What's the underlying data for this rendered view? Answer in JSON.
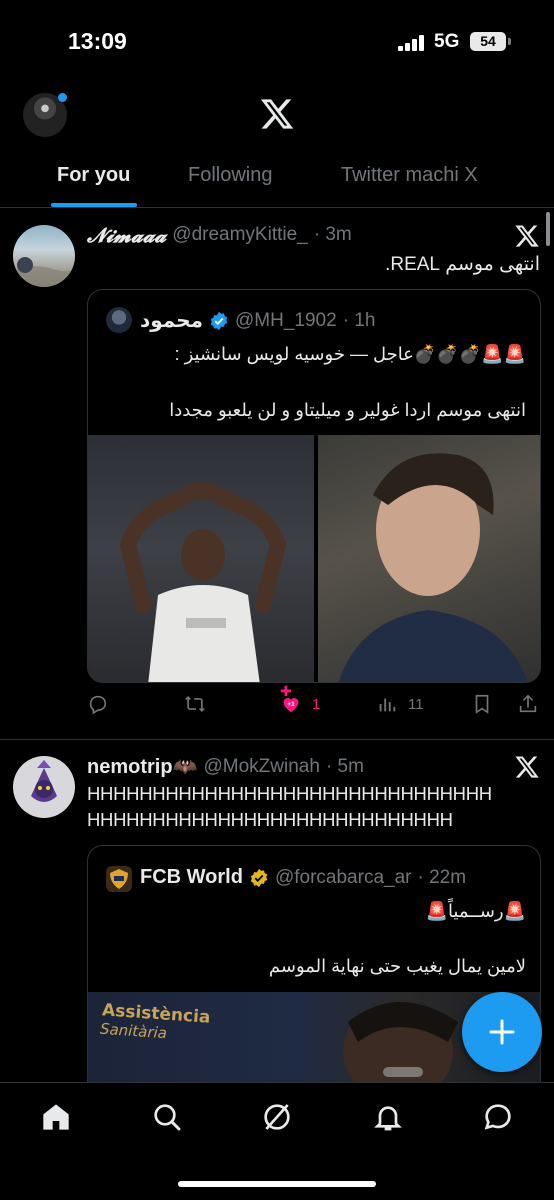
{
  "status_bar": {
    "time": "13:09",
    "network": "5G",
    "battery": "54"
  },
  "header": {
    "logo_icon": "x-logo-icon",
    "avatar_icon": "profile-avatar"
  },
  "tabs": [
    {
      "label": "For you",
      "active": true
    },
    {
      "label": "Following",
      "active": false
    },
    {
      "label": "Twitter machi X",
      "active": false
    }
  ],
  "posts": [
    {
      "display_name": "𝓝𝓲𝓶𝓪𝓪𝓪",
      "handle": "@dreamyKittie_",
      "time": "· 3m",
      "text": "انتهى موسم REAL.",
      "quote": {
        "display_name": "محمود",
        "verified": true,
        "handle": "@MH_1902",
        "time": "· 1h",
        "line1": "🚨🚨💣💣💣عاجل — خوسيه لويس سانشيز :",
        "line2": "انتهى موسم اردا غولير و ميليتاو و لن يلعبو مجددا"
      },
      "actions": {
        "reply": "",
        "repost": "",
        "like": "1",
        "like_badge": "+1",
        "views": "11"
      }
    },
    {
      "display_name": "nemotrip🦇",
      "handle": "@MokZwinah",
      "time": "· 5m",
      "text_line1": "HHHHHHHHHHHHHHHHHHHHHHHHHHHHHHH",
      "text_line2": "HHHHHHHHHHHHHHHHHHHHHHHHHHHH",
      "quote": {
        "display_name": "FCB World",
        "verified": true,
        "handle": "@forcabarca_ar",
        "time": "· 22m",
        "line1": "🚨رســمياً🚨",
        "line2": "لامين يمال يغيب حتى نهاية الموسم",
        "image_text_1": "Assistència",
        "image_text_2": "Sanitària"
      }
    }
  ],
  "colors": {
    "accent": "#1d9bf0",
    "like": "#f91880",
    "muted": "#71767b",
    "divider": "#2f3336"
  }
}
